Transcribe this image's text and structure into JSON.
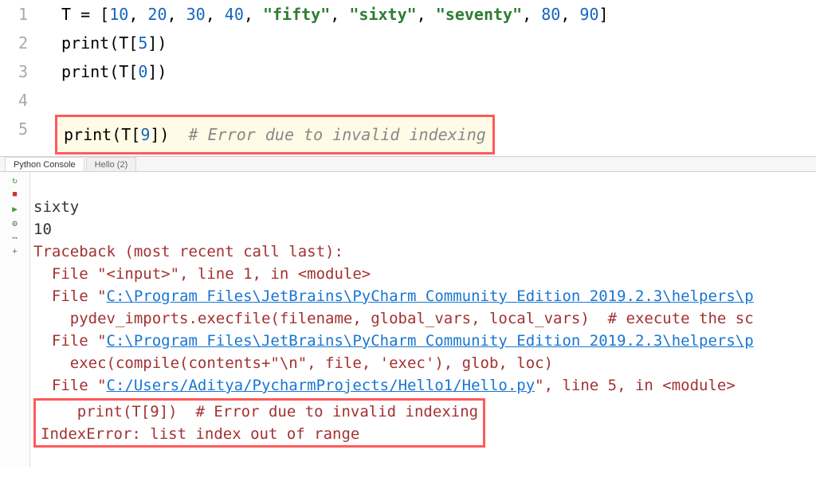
{
  "editor": {
    "lines": [
      "1",
      "2",
      "3",
      "4",
      "5"
    ],
    "code": {
      "l1a": "T = [",
      "l1_n10": "10",
      "l1_c": ", ",
      "l1_n20": "20",
      "l1_n30": "30",
      "l1_n40": "40",
      "l1_s1": "\"fifty\"",
      "l1_s2": "\"sixty\"",
      "l1_s3": "\"seventy\"",
      "l1_n80": "80",
      "l1_n90": "90",
      "l1z": "]",
      "l2a": "print(T[",
      "l2n": "5",
      "l2z": "])",
      "l3a": "print(T[",
      "l3n": "0",
      "l3z": "])",
      "l5a": "print(T[",
      "l5n": "9",
      "l5z": "])  ",
      "l5c": "# Error due to invalid indexing"
    }
  },
  "tabs": {
    "t1": "Python Console",
    "t2": "Hello (2)"
  },
  "console": {
    "out1": "sixty",
    "out2": "10",
    "tb_head": "Traceback (most recent call last):",
    "tb_l1a": "  File \"<input>\", line 1, in <module>",
    "tb_l2a": "  File \"",
    "tb_l2link": "C:\\Program Files\\JetBrains\\PyCharm Community Edition 2019.2.3\\helpers\\p",
    "tb_l3": "    pydev_imports.execfile(filename, global_vars, local_vars)  # execute the sc",
    "tb_l4a": "  File \"",
    "tb_l4link": "C:\\Program Files\\JetBrains\\PyCharm Community Edition 2019.2.3\\helpers\\p",
    "tb_l5": "    exec(compile(contents+\"\\n\", file, 'exec'), glob, loc)",
    "tb_l6a": "  File \"",
    "tb_l6link": "C:/Users/Aditya/PycharmProjects/Hello1/Hello.py",
    "tb_l6b": "\", line 5, in <module>",
    "tb_err_line": "    print(T[9])  # Error due to invalid indexing",
    "tb_err": "IndexError: list index out of range"
  }
}
